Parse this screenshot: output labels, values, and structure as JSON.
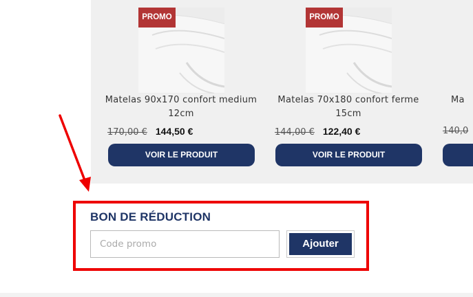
{
  "products": [
    {
      "badge": "PROMO",
      "title": "Matelas 90x170 confort medium 12cm",
      "old_price": "170,00 €",
      "new_price": "144,50 €",
      "button": "VOIR LE PRODUIT"
    },
    {
      "badge": "PROMO",
      "title": "Matelas 70x180 confort ferme 15cm",
      "old_price": "144,00 €",
      "new_price": "122,40 €",
      "button": "VOIR LE PRODUIT"
    },
    {
      "badge": "",
      "title": "Ma",
      "old_price": "140,0",
      "new_price": "",
      "button": ""
    }
  ],
  "coupon": {
    "heading": "BON DE RÉDUCTION",
    "placeholder": "Code promo",
    "value": "",
    "apply_label": "Ajouter"
  },
  "colors": {
    "brand_navy": "#1f3566",
    "promo_red": "#b23535",
    "annotation_red": "#ee0000"
  },
  "annotation": {
    "shape": "arrow-and-rectangle"
  }
}
